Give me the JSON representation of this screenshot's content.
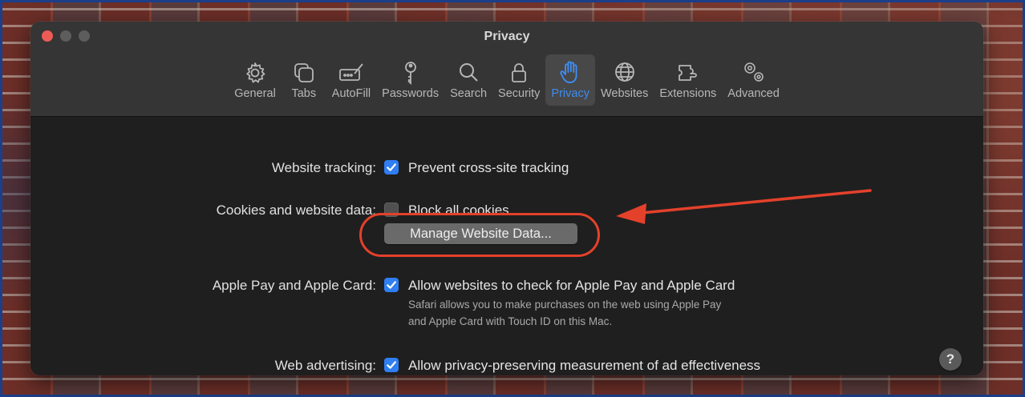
{
  "window": {
    "title": "Privacy"
  },
  "tabs": [
    {
      "label": "General",
      "icon": "gear-icon"
    },
    {
      "label": "Tabs",
      "icon": "tabs-icon"
    },
    {
      "label": "AutoFill",
      "icon": "autofill-icon"
    },
    {
      "label": "Passwords",
      "icon": "key-icon"
    },
    {
      "label": "Search",
      "icon": "magnifier-icon"
    },
    {
      "label": "Security",
      "icon": "lock-icon"
    },
    {
      "label": "Privacy",
      "icon": "hand-icon"
    },
    {
      "label": "Websites",
      "icon": "globe-icon"
    },
    {
      "label": "Extensions",
      "icon": "puzzle-icon"
    },
    {
      "label": "Advanced",
      "icon": "gears-icon"
    }
  ],
  "selected_tab": "Privacy",
  "settings": {
    "tracking": {
      "label": "Website tracking:",
      "checkbox_text": "Prevent cross-site tracking",
      "checked": true
    },
    "cookies": {
      "label": "Cookies and website data:",
      "checkbox_text": "Block all cookies",
      "checked": false,
      "button_label": "Manage Website Data..."
    },
    "applepay": {
      "label": "Apple Pay and Apple Card:",
      "checkbox_text": "Allow websites to check for Apple Pay and Apple Card",
      "checked": true,
      "help_line1": "Safari allows you to make purchases on the web using Apple Pay",
      "help_line2": "and Apple Card with Touch ID on this Mac."
    },
    "advertising": {
      "label": "Web advertising:",
      "checkbox_text": "Allow privacy-preserving measurement of ad effectiveness",
      "checked": true
    }
  },
  "help_button": "?",
  "colors": {
    "accent": "#2f7ef2",
    "selected_tab_text": "#3e8cf1",
    "annotation": "#e4412b"
  }
}
